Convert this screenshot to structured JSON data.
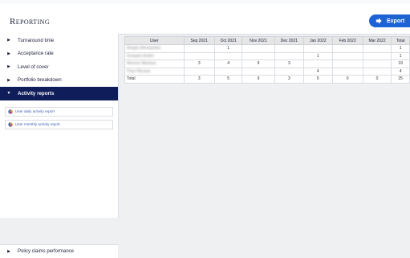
{
  "header": {
    "title": "Reporting",
    "export_label": "Export"
  },
  "sidebar": {
    "items": [
      {
        "label": "Turnaround time",
        "active": false
      },
      {
        "label": "Acceptance rate",
        "active": false
      },
      {
        "label": "Level of cover",
        "active": false
      },
      {
        "label": "Portfolio breakdown",
        "active": false
      },
      {
        "label": "Activity reports",
        "active": true
      }
    ],
    "sub_items": [
      {
        "label": "User daily activity report"
      },
      {
        "label": "User monthly activity report"
      }
    ],
    "bottom_item": {
      "label": "Policy claims performance"
    }
  },
  "report": {
    "columns": [
      "User",
      "Sep 2021",
      "Oct 2021",
      "Nov 2021",
      "Dec 2021",
      "Jan 2022",
      "Feb 2022",
      "Mar 2022",
      "Total"
    ],
    "rows": [
      [
        "Borges Alessandra",
        "",
        "1",
        "",
        "",
        "",
        "",
        "",
        "1"
      ],
      [
        "Graspen Andre",
        "",
        "",
        "",
        "",
        "1",
        "",
        "",
        "1"
      ],
      [
        "Moreno Mariana",
        "3",
        "4",
        "9",
        "3",
        "",
        "",
        "",
        "19"
      ],
      [
        "Pavo Nicosia",
        "",
        "",
        "",
        "",
        "4",
        "",
        "",
        "4"
      ]
    ],
    "total_row": [
      "Total",
      "3",
      "5",
      "9",
      "3",
      "5",
      "0",
      "0",
      "25"
    ]
  },
  "colors": {
    "accent": "#1e63d6",
    "nav_active": "#0f1d5a",
    "link": "#3a5fb0"
  }
}
